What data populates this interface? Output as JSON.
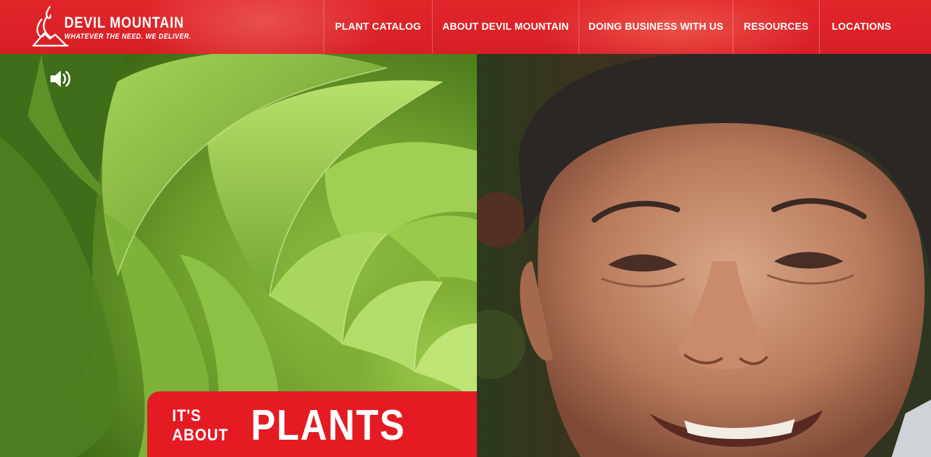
{
  "brand": {
    "name": "DEVIL MOUNTAIN",
    "tagline": "WHATEVER THE NEED. WE DELIVER.",
    "accent_color": "#e2262a"
  },
  "nav": {
    "items": [
      {
        "label": "PLANT CATALOG"
      },
      {
        "label": "ABOUT DEVIL MOUNTAIN"
      },
      {
        "label": "DOING BUSINESS WITH US"
      },
      {
        "label": "RESOURCES"
      },
      {
        "label": "LOCATIONS"
      }
    ]
  },
  "hero": {
    "sound_icon": "speaker-volume-icon",
    "left_image": "succulent-rosette-photo",
    "right_image": "smiling-man-portrait-photo",
    "banner": {
      "line1": "IT'S",
      "line2": "ABOUT",
      "headline": "PLANTS",
      "color": "#e41b23"
    }
  }
}
